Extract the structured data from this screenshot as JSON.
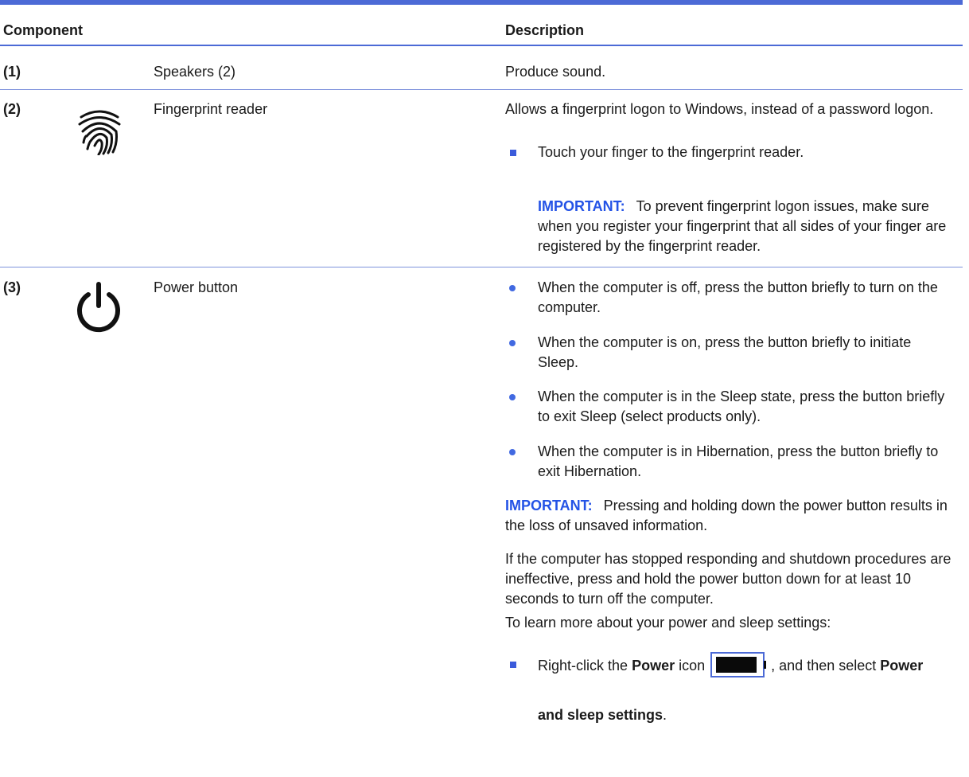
{
  "header": {
    "component": "Component",
    "description": "Description"
  },
  "rows": [
    {
      "num": "(1)",
      "name": "Speakers (2)",
      "desc": "Produce sound."
    },
    {
      "num": "(2)",
      "icon": "fingerprint-icon",
      "name": "Fingerprint reader",
      "desc": "Allows a fingerprint logon to Windows, instead of a password logon.",
      "bullet": "Touch your finger to the fingerprint reader.",
      "important_label": "IMPORTANT:",
      "important_text": "To prevent fingerprint logon issues, make sure when you register your fingerprint that all sides of your finger are registered by the fingerprint reader."
    },
    {
      "num": "(3)",
      "icon": "power-icon",
      "name": "Power button",
      "bullets": [
        "When the computer is off, press the button briefly to turn on the computer.",
        "When the computer is on, press the button briefly to initiate Sleep.",
        "When the computer is in the Sleep state, press the button briefly to exit Sleep (select products only).",
        "When the computer is in Hibernation, press the button briefly to exit Hibernation."
      ],
      "important_label": "IMPORTANT:",
      "important_text": "Pressing and holding down the power button results in the loss of unsaved information.",
      "para": "If the computer has stopped responding and shutdown procedures are ineffective, press and hold the power button down for at least 10 seconds to turn off the computer.",
      "learn_more": "To learn more about your power and sleep settings:",
      "final_step": {
        "pre": "Right-click the",
        "power_bold": "Power",
        "icon_word": "icon",
        "icon": "battery-icon",
        "mid": ", and then select",
        "setting_part1": "Power",
        "setting_part2": "and sleep settings",
        "end": "."
      }
    }
  ],
  "colors": {
    "accent": "#4c6ad6",
    "important": "#2453e6",
    "bullet": "#4169e1"
  }
}
